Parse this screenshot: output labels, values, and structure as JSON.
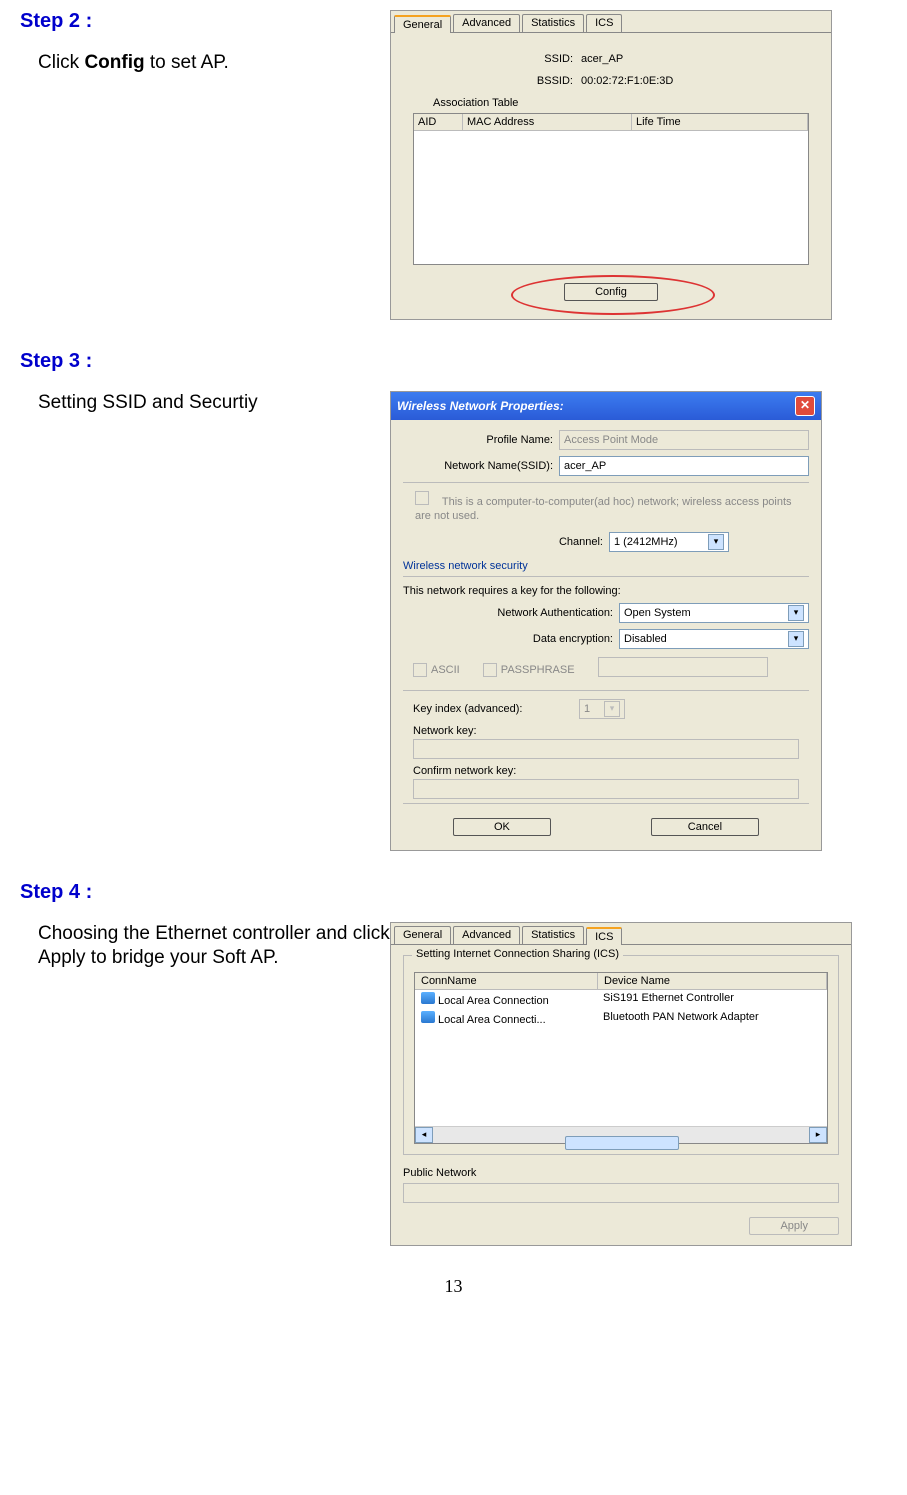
{
  "step2": {
    "title": "Step 2 :",
    "body_prefix": "Click ",
    "body_bold": "Config",
    "body_suffix": " to set AP.",
    "tabs": [
      "General",
      "Advanced",
      "Statistics",
      "ICS"
    ],
    "ssid_label": "SSID:",
    "ssid_value": "acer_AP",
    "bssid_label": "BSSID:",
    "bssid_value": "00:02:72:F1:0E:3D",
    "assoc_title": "Association Table",
    "col_aid": "AID",
    "col_mac": "MAC Address",
    "col_life": "Life Time",
    "config_btn": "Config"
  },
  "step3": {
    "title": "Step 3 :",
    "body": "Setting SSID and Securtiy",
    "win_title": "Wireless Network Properties:",
    "profile_lbl": "Profile Name:",
    "profile_val": "Access Point Mode",
    "ssid_lbl": "Network Name(SSID):",
    "ssid_val": "acer_AP",
    "adhoc_note": "This is a computer-to-computer(ad hoc) network; wireless access points are not used.",
    "channel_lbl": "Channel:",
    "channel_val": "1  (2412MHz)",
    "sec_title": "Wireless network security",
    "sec_desc": "This network requires a key for the following:",
    "auth_lbl": "Network Authentication:",
    "auth_val": "Open System",
    "enc_lbl": "Data encryption:",
    "enc_val": "Disabled",
    "ascii": "ASCII",
    "pass": "PASSPHRASE",
    "keyidx_lbl": "Key index (advanced):",
    "keyidx_val": "1",
    "netkey_lbl": "Network key:",
    "confkey_lbl": "Confirm network key:",
    "ok": "OK",
    "cancel": "Cancel"
  },
  "step4": {
    "title": "Step 4 :",
    "body": "Choosing the Ethernet controller and click Apply to bridge your Soft AP.",
    "tabs": [
      "General",
      "Advanced",
      "Statistics",
      "ICS"
    ],
    "group": "Setting Internet Connection Sharing (ICS)",
    "col_conn": "ConnName",
    "col_dev": "Device Name",
    "rows": [
      {
        "conn": "Local Area Connection",
        "dev": "SiS191 Ethernet Controller"
      },
      {
        "conn": "Local Area Connecti...",
        "dev": "Bluetooth PAN Network Adapter"
      }
    ],
    "public": "Public Network",
    "apply": "Apply"
  },
  "page_number": "13"
}
